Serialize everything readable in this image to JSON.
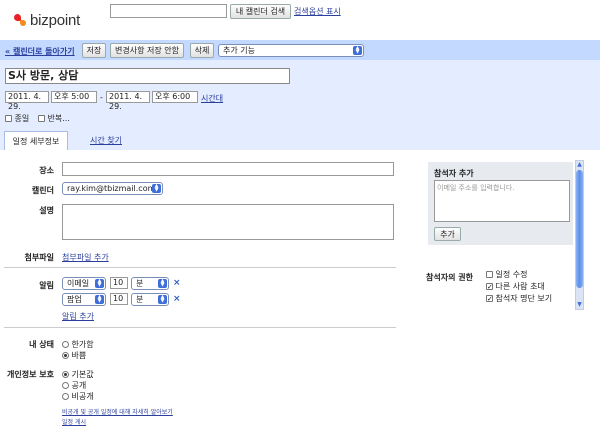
{
  "app": {
    "logo_text": "bizpoint"
  },
  "top": {
    "search_button": "내 캘린더 검색",
    "search_options": "검색옵션 표시"
  },
  "toolbar": {
    "back_link": "« 캘린더로 돌아가기",
    "save": "저장",
    "save_no_notify": "변경사항 저장 안함",
    "delete": "삭제",
    "more_actions": "추가 기능"
  },
  "event": {
    "title": "S사 방문, 상담",
    "start_date": "2011. 4. 29.",
    "start_time": "오후 5:00",
    "dash": "-",
    "end_date": "2011. 4. 29.",
    "end_time": "오후 6:00",
    "timezone_link": "시간대",
    "all_day_label": "종일",
    "repeat_label": "반복..."
  },
  "tabs": {
    "details": "일정 세부정보",
    "find_time": "시간 찾기"
  },
  "details": {
    "where_label": "장소",
    "calendar_label": "캘린더",
    "calendar_value": "ray.kim@tbizmail.com",
    "description_label": "설명",
    "attachment_label": "첨부파일",
    "attachment_link": "첨부파일 추가",
    "reminder_label": "알림",
    "reminders": [
      {
        "method": "이메일",
        "amount": "10",
        "unit": "분"
      },
      {
        "method": "팝업",
        "amount": "10",
        "unit": "분"
      }
    ],
    "add_reminder": "알림 추가",
    "status_label": "내 상태",
    "status_options": [
      "한가함",
      "바쁨"
    ],
    "status_selected": 1,
    "privacy_label": "개인정보 보호",
    "privacy_options": [
      "기본값",
      "공개",
      "비공개"
    ],
    "privacy_selected": 0,
    "privacy_learn_more": "비공개 및 공개 일정에 대해 자세히 알아보기",
    "publish_event": "일정 게시"
  },
  "guests": {
    "title": "참석자 추가",
    "placeholder": "이메일 주소를 입력합니다.",
    "add_button": "추가",
    "permissions_label": "참석자의 권한",
    "permissions": [
      {
        "label": "일정 수정",
        "checked": false
      },
      {
        "label": "다른 사람 초대",
        "checked": true
      },
      {
        "label": "참석자 명단 보기",
        "checked": true
      }
    ]
  },
  "colors": {
    "toolbar_bg": "#c3d9ff",
    "header_bg": "#e4edff",
    "link": "#2b3f9e",
    "logo_red": "#e8222a",
    "logo_orange": "#f28c1e"
  }
}
